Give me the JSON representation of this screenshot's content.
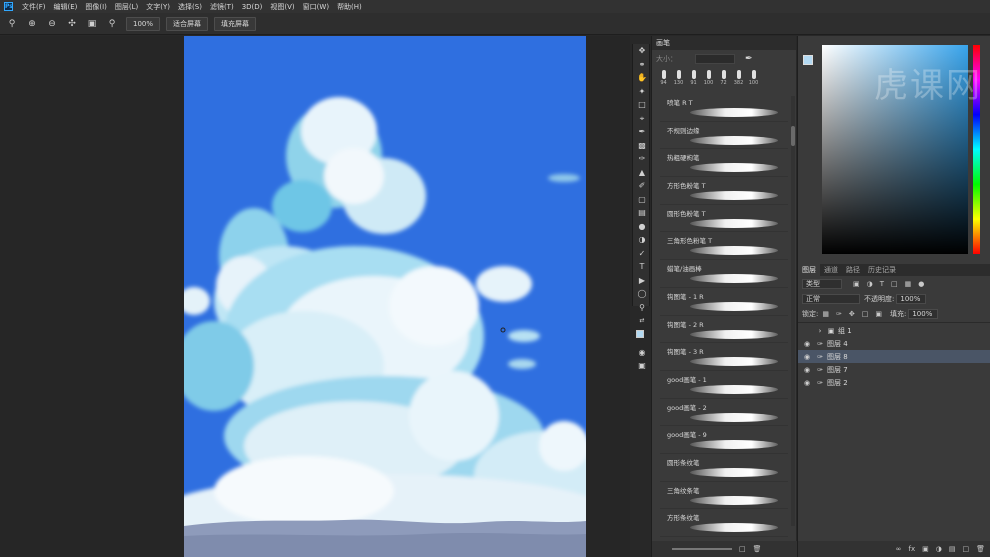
{
  "menubar": {
    "logo": "Ps",
    "items": [
      "文件(F)",
      "编辑(E)",
      "图像(I)",
      "图层(L)",
      "文字(Y)",
      "选择(S)",
      "滤镜(T)",
      "3D(D)",
      "视图(V)",
      "窗口(W)",
      "帮助(H)"
    ]
  },
  "options": {
    "zoom_value": "100%",
    "fit_screen": "适合屏幕",
    "fill_screen": "填充屏幕"
  },
  "brushes": {
    "tab": "画笔",
    "size_label": "大小：",
    "presets": [
      "94",
      "130",
      "91",
      "100",
      "72",
      "382",
      "100"
    ],
    "items": [
      "喷笔 R T",
      "不规则边缘",
      "热粗硬枸笔",
      "方形色粉笔 T",
      "圆形色粉笔 T",
      "三角形色粉笔 T",
      "蜡笔/油画棒",
      "钩图笔 - 1 R",
      "钩图笔 - 2 R",
      "钩图笔 - 3 R",
      "good画笔 - 1",
      "good画笔 - 2",
      "good画笔 - 9",
      "圆形条纹笔",
      "三角纹条笔",
      "方形条纹笔"
    ]
  },
  "layers": {
    "tabs": [
      "图层",
      "通道",
      "路径",
      "历史记录"
    ],
    "filter_label": "类型",
    "blend_mode": "正常",
    "opacity_label": "不透明度:",
    "opacity_value": "100%",
    "lock_label": "锁定:",
    "fill_label": "填充:",
    "fill_value": "100%",
    "items": [
      {
        "name": "组 1",
        "type": "group",
        "visible": false,
        "selected": false
      },
      {
        "name": "图层 4",
        "type": "layer",
        "visible": true,
        "selected": false
      },
      {
        "name": "图层 8",
        "type": "layer",
        "visible": true,
        "selected": true
      },
      {
        "name": "图层 7",
        "type": "layer",
        "visible": true,
        "selected": false
      },
      {
        "name": "图层 2",
        "type": "layer",
        "visible": true,
        "selected": false
      }
    ],
    "footer_icons": [
      "link-icon",
      "fx-icon",
      "mask-icon",
      "adjustment-icon",
      "folder-icon",
      "new-layer-icon",
      "trash-icon"
    ]
  },
  "colors": {
    "foreground": "#b3d9f2",
    "background": "#111111",
    "sky": "#2f6fe0"
  },
  "watermark": "虎课网"
}
